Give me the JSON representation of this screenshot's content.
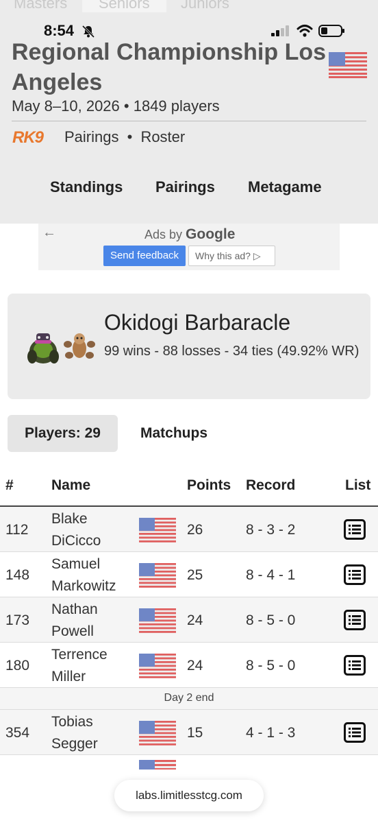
{
  "division_tabs": [
    "Masters",
    "Seniors",
    "Juniors"
  ],
  "status_bar": {
    "time": "8:54"
  },
  "event": {
    "title": "Regional Championship Los Angeles",
    "meta": "May 8–10, 2026 • 1849 players",
    "organizer_logo": "RK9",
    "links": [
      "Pairings",
      "•",
      "Roster"
    ]
  },
  "nav": [
    "Standings",
    "Pairings",
    "Metagame"
  ],
  "ad": {
    "back_arrow": "←",
    "label_prefix": "Ads by",
    "label_brand": "Google",
    "feedback": "Send feedback",
    "why": "Why this ad? ▷"
  },
  "deck": {
    "name": "Okidogi Barbaracle",
    "stats": "99 wins - 88 losses - 34 ties (49.92% WR)"
  },
  "tabs": {
    "players": "Players: 29",
    "matchups": "Matchups"
  },
  "table": {
    "headers": [
      "#",
      "Name",
      "Points",
      "Record",
      "List"
    ],
    "rows": [
      {
        "rank": "112",
        "name": "Blake DiCicco",
        "points": "26",
        "record": "8 - 3 - 2"
      },
      {
        "rank": "148",
        "name": "Samuel Markowitz",
        "points": "25",
        "record": "8 - 4 - 1"
      },
      {
        "rank": "173",
        "name": "Nathan Powell",
        "points": "24",
        "record": "8 - 5 - 0"
      },
      {
        "rank": "180",
        "name": "Terrence Miller",
        "points": "24",
        "record": "8 - 5 - 0"
      }
    ],
    "divider": "Day 2 end",
    "rows_after": [
      {
        "rank": "354",
        "name": "Tobias Segger",
        "points": "15",
        "record": "4 - 1 - 3"
      }
    ]
  },
  "url": "labs.limitlesstcg.com"
}
